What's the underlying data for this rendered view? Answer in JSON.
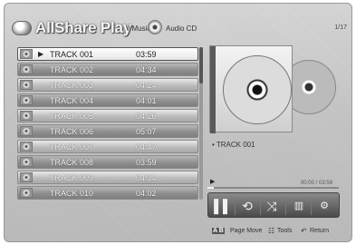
{
  "header": {
    "app_title": "AllShare Play",
    "crumb_music": "/ Music /",
    "crumb_audio": "Audio CD",
    "page_count": "1/17"
  },
  "tracks": [
    {
      "name": "TRACK 001",
      "time": "03:59",
      "playing": true
    },
    {
      "name": "TRACK 002",
      "time": "04:34"
    },
    {
      "name": "TRACK 003",
      "time": "04:24"
    },
    {
      "name": "TRACK 004",
      "time": "04:01"
    },
    {
      "name": "TRACK 005",
      "time": "04:26"
    },
    {
      "name": "TRACK 006",
      "time": "05:07"
    },
    {
      "name": "TRACK 007",
      "time": "04:47"
    },
    {
      "name": "TRACK 008",
      "time": "03:59"
    },
    {
      "name": "TRACK 009",
      "time": "04:34"
    },
    {
      "name": "TRACK 010",
      "time": "04:02"
    }
  ],
  "now_playing": {
    "label": "TRACK 001",
    "play_symbol": "▶",
    "elapsed": "00:00 / 03:59",
    "progress_fraction": 0.05
  },
  "controls": {
    "pause": "▌▌",
    "repeat": "⟲",
    "shuffle": "⤨",
    "eq": "▥",
    "settings": "⚙"
  },
  "footer": {
    "ab_buttons": "A B",
    "page_move": "Page Move",
    "tools_icon": "☷",
    "tools": "Tools",
    "return_icon": "↶",
    "return": "Return"
  }
}
